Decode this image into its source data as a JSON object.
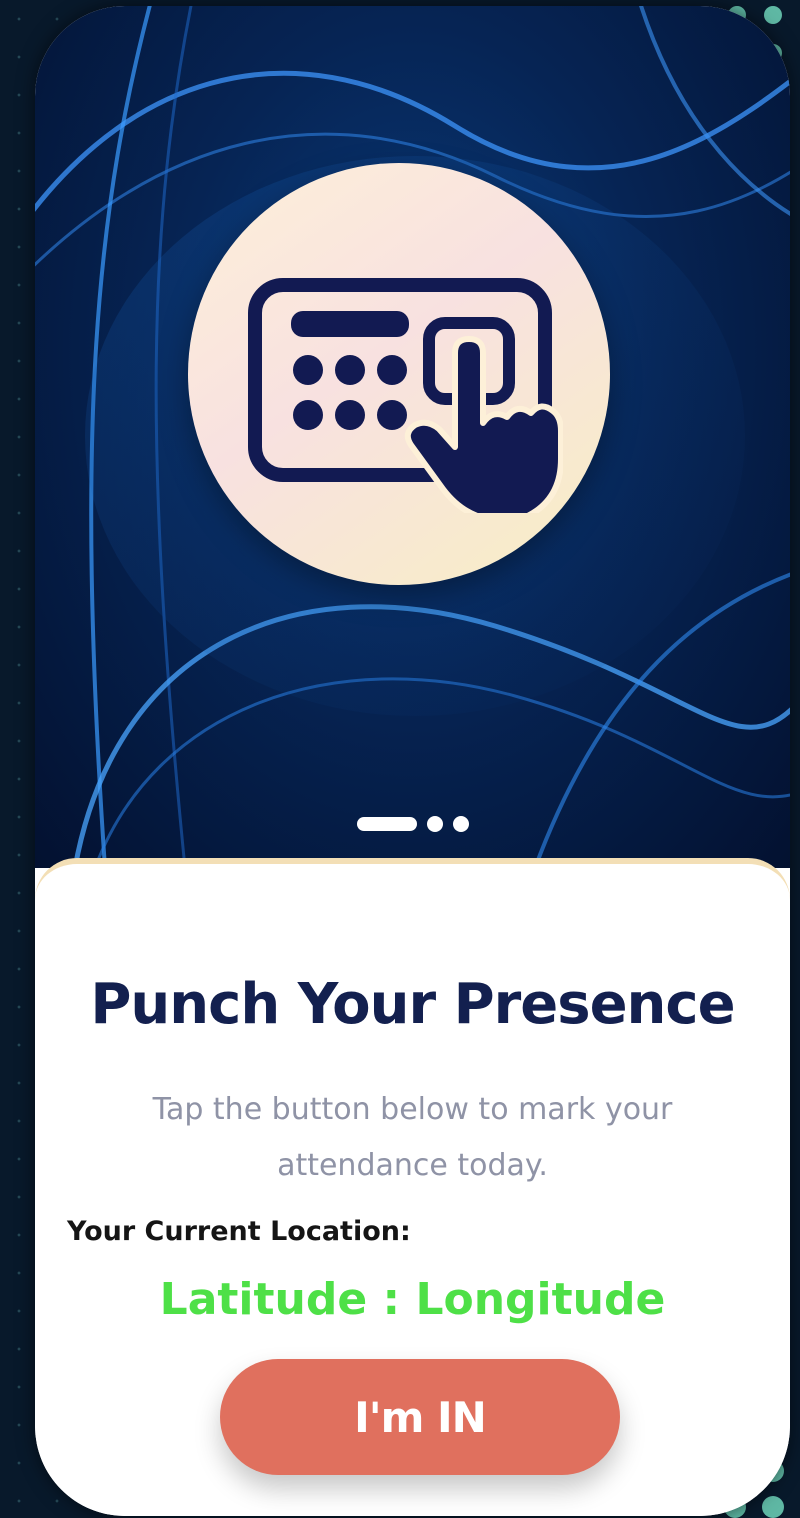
{
  "onboarding": {
    "title": "Punch Your Presence",
    "subtitle": "Tap the button below to mark your attendance today.",
    "location_label": "Your Current Location:",
    "coordinates_text": "Latitude : Longitude",
    "punch_button_label": "I'm IN"
  },
  "carousel": {
    "total_pages": 3,
    "active_page": 1
  },
  "icons": {
    "hero_icon": "keypad-touch-icon"
  },
  "colors": {
    "title": "#13204f",
    "subtitle": "#8f93a6",
    "coordinates": "#4ee047",
    "button": "#e0705e",
    "hero_background": "#062454",
    "page_background": "#08192b"
  }
}
